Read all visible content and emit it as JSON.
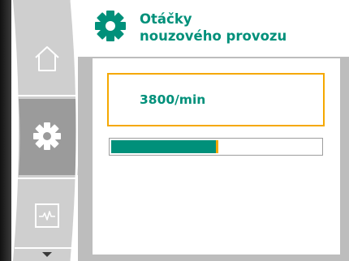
{
  "header": {
    "icon": "gear-icon",
    "title_line1": "Otáčky",
    "title_line2": "nouzového provozu"
  },
  "sidebar": {
    "items": [
      {
        "id": "home",
        "icon": "home-icon",
        "active": false
      },
      {
        "id": "settings",
        "icon": "gear-icon",
        "active": true
      },
      {
        "id": "diagnostics",
        "icon": "pulse-icon",
        "active": false
      },
      {
        "id": "more",
        "icon": "chevron-down-icon",
        "active": false
      }
    ]
  },
  "setting": {
    "value": "3800/min",
    "level_fraction": 0.5
  },
  "colors": {
    "accent": "#00907a",
    "highlight": "#f5a800",
    "rail": "#c8c8c8",
    "rail_active": "#999999",
    "frame": "#bdbdbd"
  }
}
